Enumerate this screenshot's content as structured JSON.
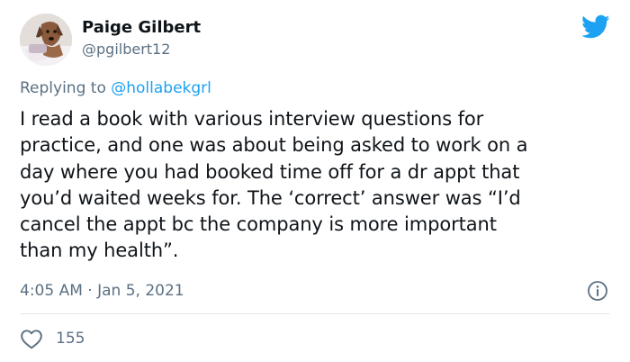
{
  "tweet": {
    "author_name": "Paige Gilbert",
    "author_handle": "@pgilbert12",
    "replying_prefix": "Replying to ",
    "replying_to": "@hollabekgrl",
    "text_lines": [
      "I read a book with various interview questions for",
      "practice, and one was about being asked to work on a",
      "day where you had booked time off for a dr appt that",
      "you’d waited weeks for. The ‘correct’ answer was “I’d",
      "cancel the appt bc the company is more important",
      "than my health”."
    ],
    "timestamp": "4:05 AM · Jan 5, 2021",
    "like_count": "155"
  },
  "icons": {
    "brand": "twitter-bird-icon",
    "info": "info-icon",
    "like": "heart-icon"
  },
  "colors": {
    "brand": "#1da1f2",
    "secondary_text": "#5b7083",
    "primary_text": "#0f1419",
    "divider": "#e1e8ed"
  }
}
